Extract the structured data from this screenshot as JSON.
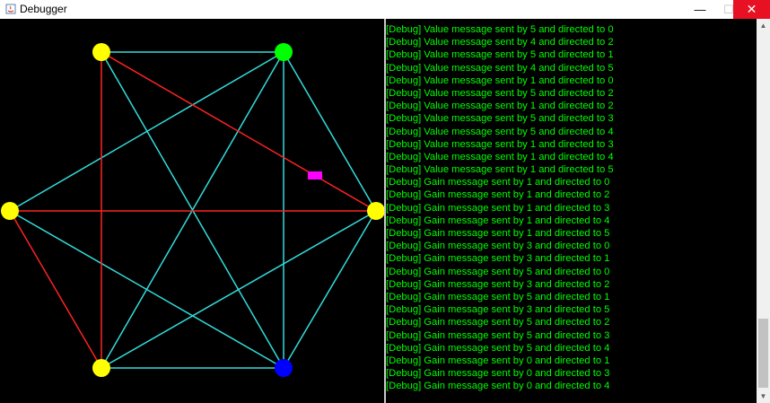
{
  "window": {
    "title": "Debugger",
    "controls": {
      "minimize": "—",
      "maximize": "☐",
      "close": "✕"
    }
  },
  "graph": {
    "background": "#000000",
    "colors": {
      "edge_default": "#33dddd",
      "edge_highlight": "#ff2222",
      "message_packet": "#ff00ff"
    },
    "nodes": [
      {
        "name": "node-top-left",
        "color": "#ffff00"
      },
      {
        "name": "node-top-right",
        "color": "#00ff00"
      },
      {
        "name": "node-left",
        "color": "#ffff00"
      },
      {
        "name": "node-right",
        "color": "#ffff00"
      },
      {
        "name": "node-bottom-left",
        "color": "#ffff00"
      },
      {
        "name": "node-bottom-right",
        "color": "#0000ff"
      }
    ]
  },
  "console": {
    "text_color": "#00ff00",
    "lines": [
      "[Debug] Value message sent by 5 and directed to 0",
      "[Debug] Value message sent by 4 and directed to 2",
      "[Debug] Value message sent by 5 and directed to 1",
      "[Debug] Value message sent by 4 and directed to 5",
      "[Debug] Value message sent by 1 and directed to 0",
      "[Debug] Value message sent by 5 and directed to 2",
      "[Debug] Value message sent by 1 and directed to 2",
      "[Debug] Value message sent by 5 and directed to 3",
      "[Debug] Value message sent by 5 and directed to 4",
      "[Debug] Value message sent by 1 and directed to 3",
      "[Debug] Value message sent by 1 and directed to 4",
      "[Debug] Value message sent by 1 and directed to 5",
      "[Debug] Gain message sent by 1 and directed to 0",
      "[Debug] Gain message sent by 1 and directed to 2",
      "[Debug] Gain message sent by 1 and directed to 3",
      "[Debug] Gain message sent by 1 and directed to 4",
      "[Debug] Gain message sent by 1 and directed to 5",
      "[Debug] Gain message sent by 3 and directed to 0",
      "[Debug] Gain message sent by 3 and directed to 1",
      "[Debug] Gain message sent by 5 and directed to 0",
      "[Debug] Gain message sent by 3 and directed to 2",
      "[Debug] Gain message sent by 5 and directed to 1",
      "[Debug] Gain message sent by 3 and directed to 5",
      "[Debug] Gain message sent by 5 and directed to 2",
      "[Debug] Gain message sent by 5 and directed to 3",
      "[Debug] Gain message sent by 5 and directed to 4",
      "[Debug] Gain message sent by 0 and directed to 1",
      "[Debug] Gain message sent by 0 and directed to 3",
      "[Debug] Gain message sent by 0 and directed to 4"
    ]
  },
  "scrollbar": {
    "up_icon": "▲",
    "down_icon": "▼"
  }
}
